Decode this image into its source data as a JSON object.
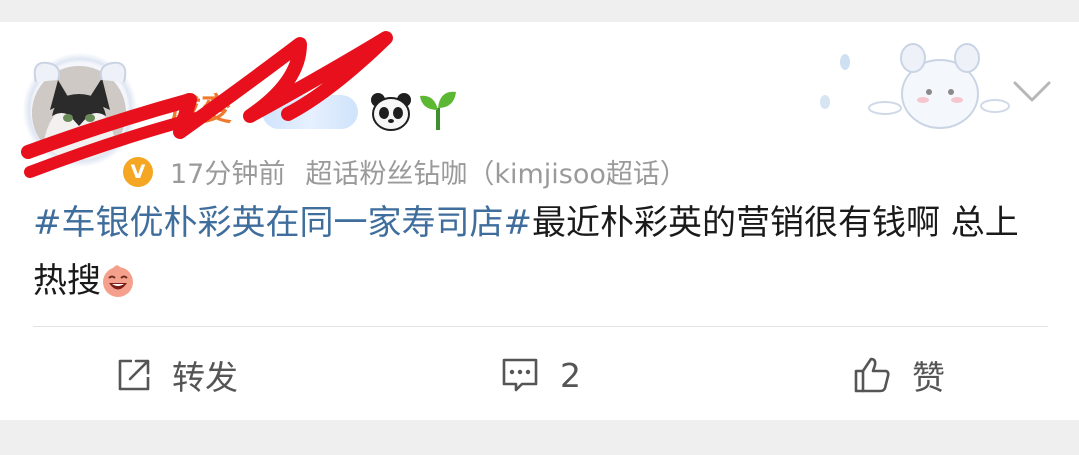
{
  "post": {
    "username": "成变",
    "meta_time": "17分钟前",
    "meta_source": "超话粉丝钻咖（kimjisoo超话）",
    "content_topic": "#车银优朴彩英在同一家寿司店#",
    "content_text": "最近朴彩英的营销很有钱啊 总上热搜",
    "verified_badge_glyph": "V"
  },
  "actions": {
    "repost_label": "转发",
    "comment_count": "2",
    "like_label": "赞"
  },
  "icons": {
    "panda": "panda-emoji-icon",
    "sprout": "sprout-emoji-icon",
    "laugh": "laughing-emoji-icon",
    "repost": "share-icon",
    "comment": "comment-icon",
    "like": "thumbs-up-icon",
    "more": "chevron-down-icon"
  },
  "colors": {
    "username": "#f07a2c",
    "topic_link": "#3f6e9c",
    "meta": "#9a9a9a",
    "redaction": "#e8101c",
    "verified": "#f5a623"
  }
}
